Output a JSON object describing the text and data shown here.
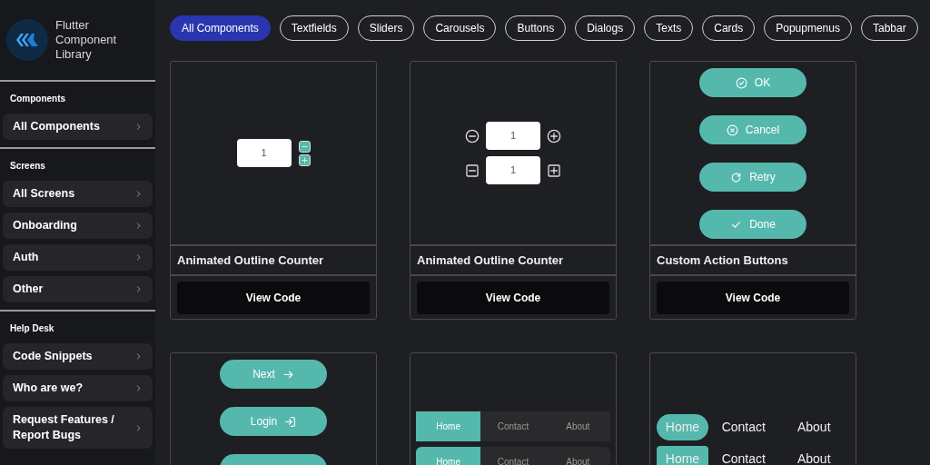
{
  "app": {
    "title": "Flutter Component Library"
  },
  "sidebar": {
    "sections": [
      {
        "heading": "Components",
        "items": [
          {
            "label": "All Components"
          }
        ]
      },
      {
        "heading": "Screens",
        "items": [
          {
            "label": "All Screens"
          },
          {
            "label": "Onboarding"
          },
          {
            "label": "Auth"
          },
          {
            "label": "Other"
          }
        ]
      },
      {
        "heading": "Help Desk",
        "items": [
          {
            "label": "Code Snippets"
          },
          {
            "label": "Who are we?"
          },
          {
            "label": "Request Features / Report Bugs"
          }
        ]
      }
    ]
  },
  "filters": [
    {
      "label": "All Components",
      "selected": true
    },
    {
      "label": "Textfields",
      "selected": false
    },
    {
      "label": "Sliders",
      "selected": false
    },
    {
      "label": "Carousels",
      "selected": false
    },
    {
      "label": "Buttons",
      "selected": false
    },
    {
      "label": "Dialogs",
      "selected": false
    },
    {
      "label": "Texts",
      "selected": false
    },
    {
      "label": "Cards",
      "selected": false
    },
    {
      "label": "Popupmenus",
      "selected": false
    },
    {
      "label": "Tabbar",
      "selected": false
    }
  ],
  "cards": [
    {
      "kind": "counter_stack",
      "values": [
        "1"
      ],
      "title": "Animated Outline Counter",
      "button": "View Code"
    },
    {
      "kind": "counter_outline",
      "values": [
        "1",
        "1"
      ],
      "title": "Animated Outline Counter",
      "button": "View Code"
    },
    {
      "kind": "action_buttons",
      "buttons": [
        {
          "kind": "labeled",
          "label": "OK"
        },
        {
          "kind": "labeled",
          "label": "Cancel"
        },
        {
          "kind": "labeled",
          "label": "Retry"
        },
        {
          "kind": "labeled",
          "label": "Done"
        }
      ],
      "title": "Custom Action Buttons",
      "button": "View Code"
    },
    {
      "kind": "action_buttons_top",
      "buttons": [
        {
          "kind": "labeled",
          "label": "Next"
        },
        {
          "kind": "labeled",
          "label": "Login"
        },
        {
          "kind": "cut_off"
        }
      ]
    },
    {
      "kind": "tabbar_square",
      "bars": [
        [
          {
            "label": "Home",
            "selected": true
          },
          {
            "label": "Contact",
            "selected": false
          },
          {
            "label": "About",
            "selected": false
          }
        ],
        [
          {
            "label": "Home",
            "selected": true
          },
          {
            "label": "Contact",
            "selected": false
          },
          {
            "label": "About",
            "selected": false
          }
        ]
      ]
    },
    {
      "kind": "tabbar_pill",
      "bars": [
        [
          {
            "label": "Home",
            "selected": true
          },
          {
            "label": "Contact",
            "selected": false
          },
          {
            "label": "About",
            "selected": false
          }
        ],
        [
          {
            "label": "Home",
            "selected": true
          },
          {
            "label": "Contact",
            "selected": false
          },
          {
            "label": "About",
            "selected": false
          }
        ]
      ]
    }
  ]
}
